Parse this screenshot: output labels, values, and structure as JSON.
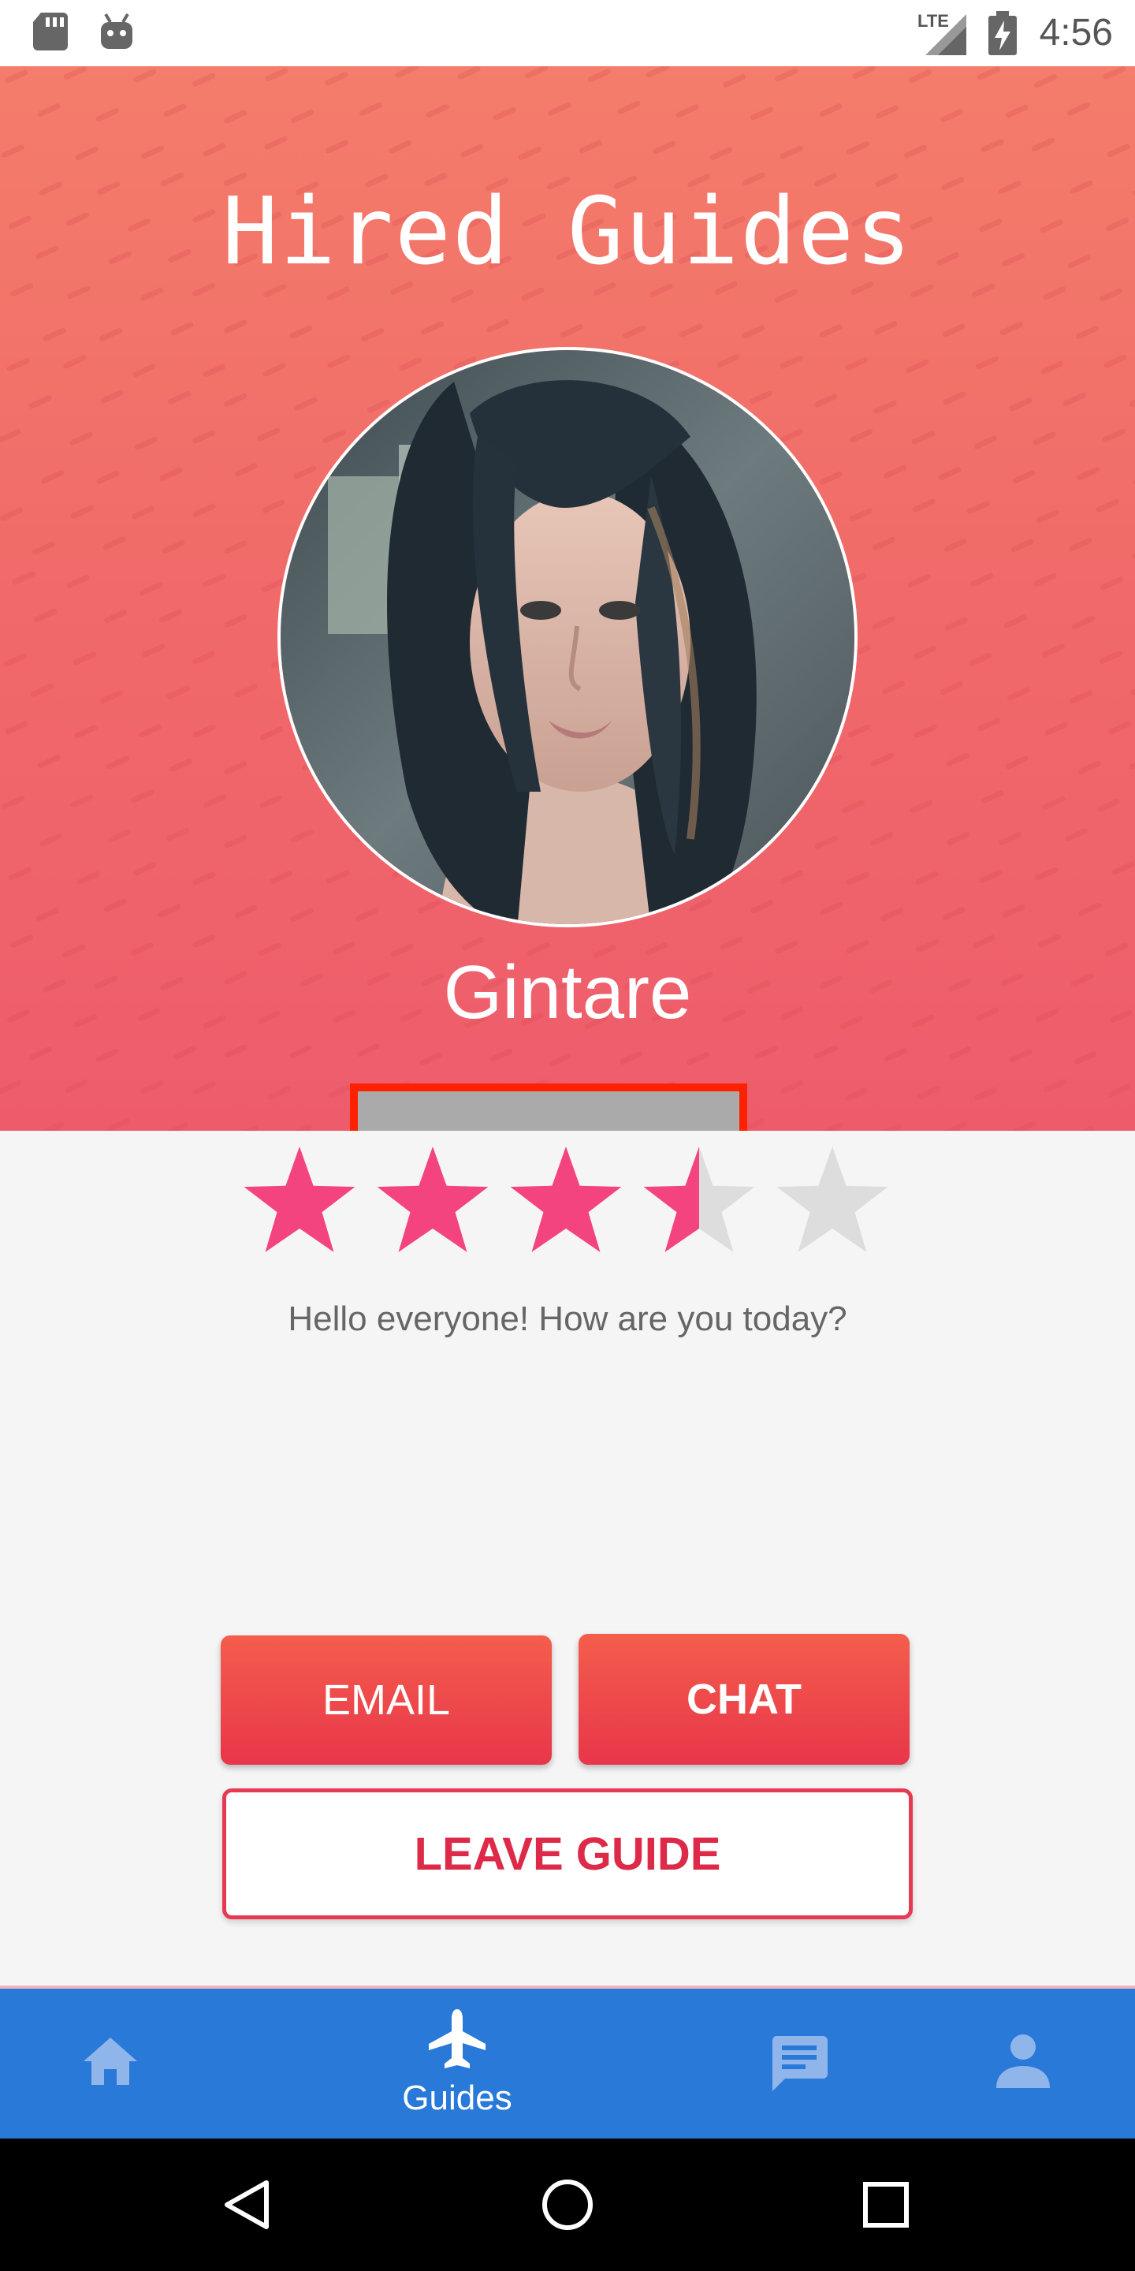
{
  "status_bar": {
    "time": "4:56",
    "network": "LTE",
    "icons": [
      "sd-card-icon",
      "android-debug-icon",
      "signal-icon",
      "battery-charging-icon"
    ]
  },
  "header": {
    "title": "Hired Guides",
    "guide_name": "Gintare",
    "background_color": "#f06a69"
  },
  "profile": {
    "rating": 3.5,
    "rating_max": 5,
    "bio": "Hello everyone! How are you today?",
    "star_color": "#f4447f"
  },
  "actions": {
    "email_label": "EMAIL",
    "chat_label": "CHAT",
    "leave_label": "LEAVE GUIDE"
  },
  "bottom_nav": {
    "items": [
      {
        "icon": "home-icon",
        "label": ""
      },
      {
        "icon": "airplane-icon",
        "label": "Guides"
      },
      {
        "icon": "chat-icon",
        "label": ""
      },
      {
        "icon": "person-icon",
        "label": ""
      }
    ],
    "background_color": "#2979d9"
  },
  "system_nav": {
    "icons": [
      "back-icon",
      "home-circle-icon",
      "recents-icon"
    ]
  }
}
